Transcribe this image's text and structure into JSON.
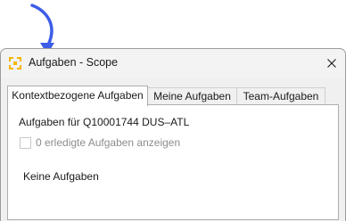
{
  "window": {
    "title": "Aufgaben - Scope"
  },
  "tabs": [
    {
      "label": "Kontextbezogene Aufgaben",
      "active": true
    },
    {
      "label": "Meine Aufgaben",
      "active": false
    },
    {
      "label": "Team-Aufgaben",
      "active": false
    }
  ],
  "panel": {
    "heading": "Aufgaben für Q10001744 DUS–ATL",
    "show_completed_label": "0 erledigte Aufgaben anzeigen",
    "show_completed_checked": false,
    "show_completed_enabled": false,
    "empty_message": "Keine Aufgaben"
  },
  "icons": {
    "pointer": "pointer-arrow-icon",
    "app": "app-logo-icon",
    "close": "close-icon"
  },
  "colors": {
    "pointer_arrow": "#3d5ce8",
    "app_icon": "#f5b400"
  }
}
